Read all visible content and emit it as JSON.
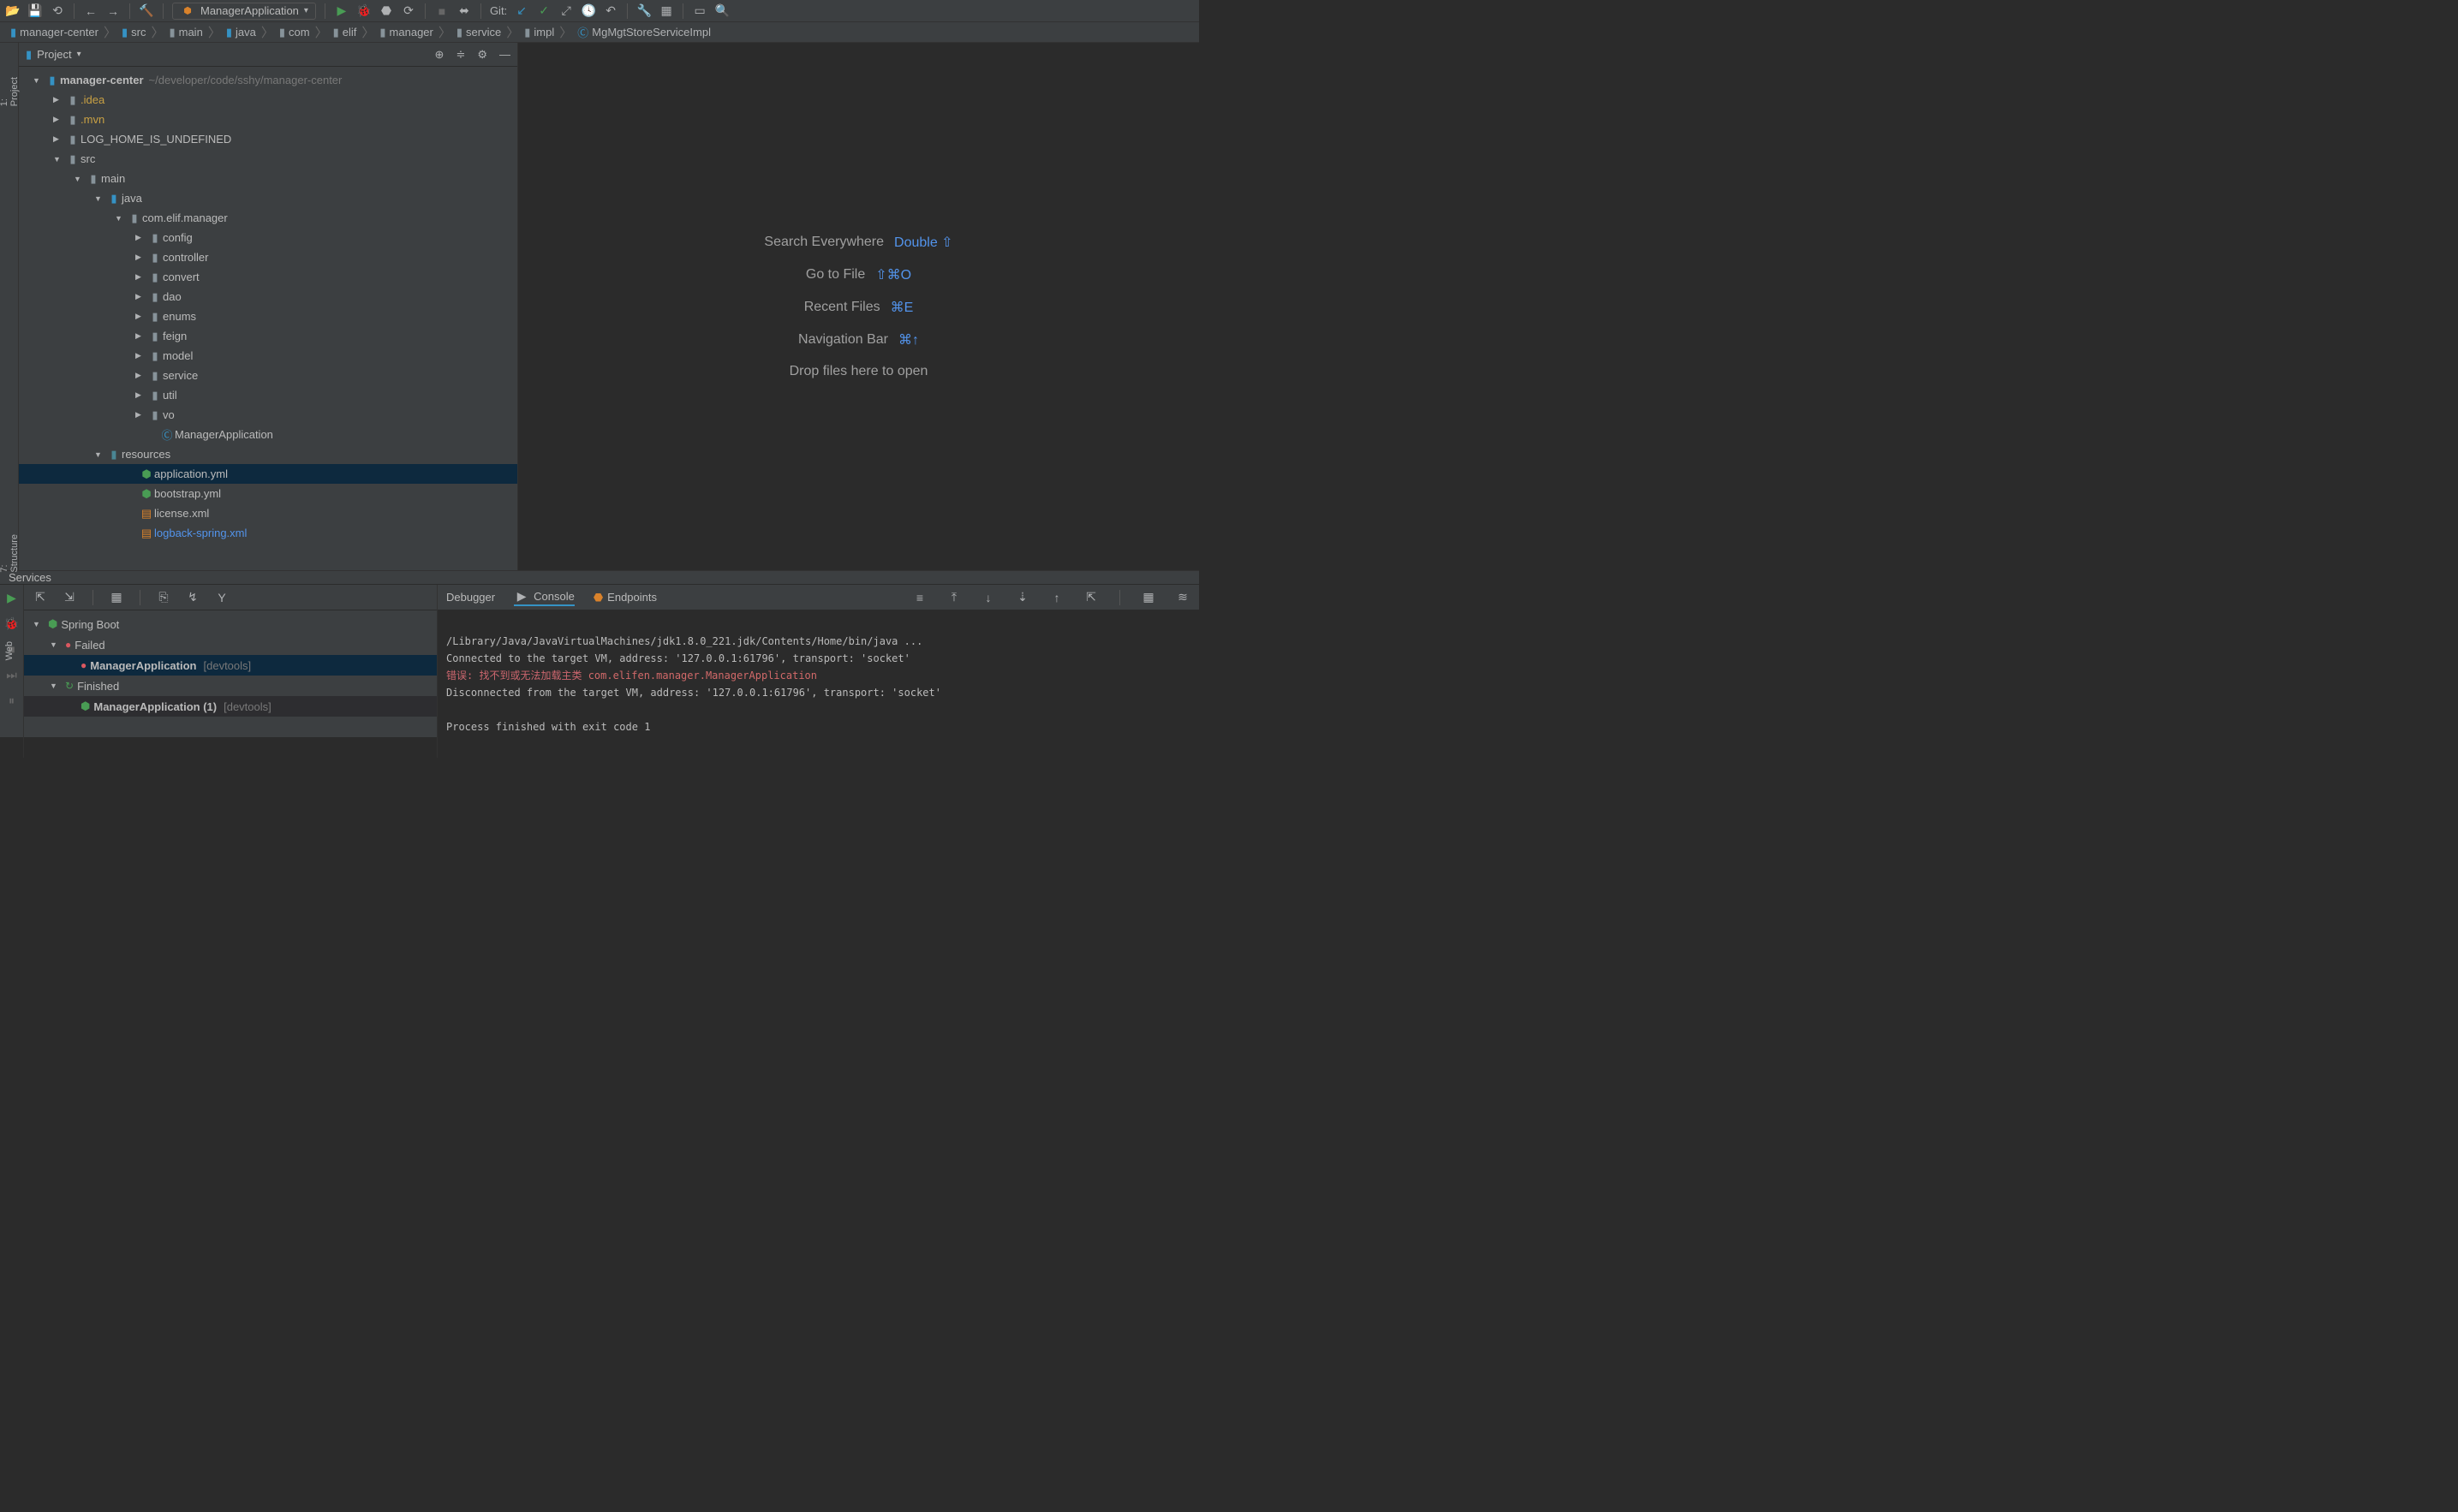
{
  "toolbar": {
    "run_config": "ManagerApplication",
    "git_label": "Git:"
  },
  "breadcrumb": [
    "manager-center",
    "src",
    "main",
    "java",
    "com",
    "elif",
    "manager",
    "service",
    "impl",
    "MgMgtStoreServiceImpl"
  ],
  "project": {
    "title": "Project",
    "root_name": "manager-center",
    "root_path": "~/developer/code/sshy/manager-center",
    "nodes": {
      "idea": ".idea",
      "mvn": ".mvn",
      "log_home": "LOG_HOME_IS_UNDEFINED",
      "src": "src",
      "main": "main",
      "java": "java",
      "pkg": "com.elif.manager",
      "config": "config",
      "controller": "controller",
      "convert": "convert",
      "dao": "dao",
      "enums": "enums",
      "feign": "feign",
      "model": "model",
      "service": "service",
      "util": "util",
      "vo": "vo",
      "app_class": "ManagerApplication",
      "resources": "resources",
      "app_yml": "application.yml",
      "bootstrap_yml": "bootstrap.yml",
      "license_xml": "license.xml",
      "logback_xml": "logback-spring.xml"
    }
  },
  "sidebar": {
    "project": "1: Project",
    "structure": "7: Structure",
    "web": "Web"
  },
  "tips": [
    {
      "label": "Search Everywhere",
      "shortcut": "Double ⇧"
    },
    {
      "label": "Go to File",
      "shortcut": "⇧⌘O"
    },
    {
      "label": "Recent Files",
      "shortcut": "⌘E"
    },
    {
      "label": "Navigation Bar",
      "shortcut": "⌘↑"
    },
    {
      "label": "Drop files here to open",
      "shortcut": ""
    }
  ],
  "services": {
    "title": "Services",
    "tree": {
      "spring_boot": "Spring Boot",
      "failed": "Failed",
      "app_failed": "ManagerApplication",
      "app_failed_suffix": "[devtools]",
      "finished": "Finished",
      "app_finished": "ManagerApplication (1)",
      "app_finished_suffix": "[devtools]"
    },
    "tabs": {
      "debugger": "Debugger",
      "console": "Console",
      "endpoints": "Endpoints"
    },
    "console": {
      "line1": "/Library/Java/JavaVirtualMachines/jdk1.8.0_221.jdk/Contents/Home/bin/java ...",
      "line2": "Connected to the target VM, address: '127.0.0.1:61796', transport: 'socket'",
      "line3a": "错误: 找不到或无法加载主类 ",
      "line3b": "com.elifen.manager.ManagerApplication",
      "line4": "Disconnected from the target VM, address: '127.0.0.1:61796', transport: 'socket'",
      "line5": "",
      "line6": "Process finished with exit code 1"
    }
  }
}
